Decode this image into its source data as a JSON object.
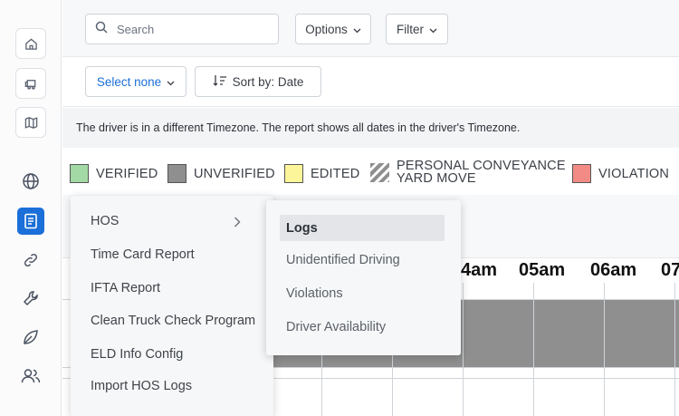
{
  "sidebar": {
    "icons": [
      "home-icon",
      "truck-icon",
      "map-icon",
      "globe-icon",
      "report-icon",
      "link-icon",
      "wrench-icon",
      "leaf-icon",
      "users-icon"
    ]
  },
  "toolbar": {
    "search_placeholder": "Search",
    "options_label": "Options",
    "filter_label": "Filter",
    "select_label": "Select none",
    "sort_label": "Sort by: Date"
  },
  "notice": "The driver is in a different Timezone. The report shows all dates in the driver's Timezone.",
  "legend": {
    "verified": "VERIFIED",
    "unverified": "UNVERIFIED",
    "edited": "EDITED",
    "pc_line1": "PERSONAL CONVEYANCE",
    "pc_line2": "YARD MOVE",
    "violation": "VIOLATION",
    "colors": {
      "verified": "#a3d9a5",
      "unverified": "#8f8f8f",
      "edited": "#fdf59a",
      "violation": "#f28b85"
    }
  },
  "grid": {
    "hours": [
      "4am",
      "05am",
      "06am",
      "07"
    ]
  },
  "menu": {
    "items": [
      "HOS",
      "Time Card Report",
      "IFTA Report",
      "Clean Truck Check Program",
      "ELD Info Config",
      "Import HOS Logs"
    ],
    "submenu": [
      "Logs",
      "Unidentified Driving",
      "Violations",
      "Driver Availability"
    ]
  }
}
